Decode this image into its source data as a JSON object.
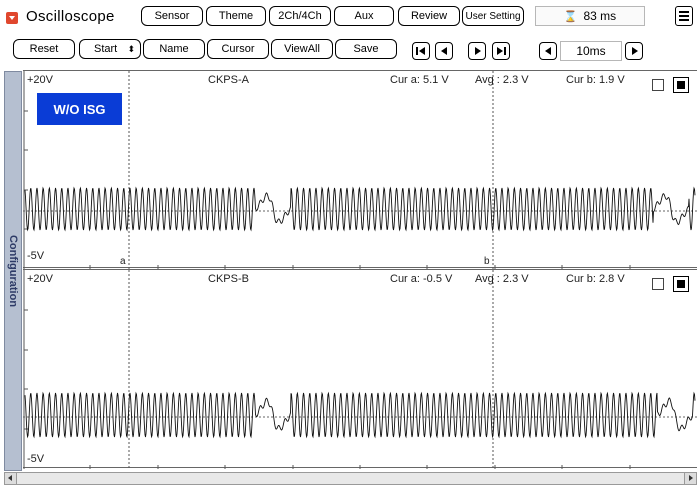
{
  "app": {
    "title": "Oscilloscope",
    "icon": "dropdown-icon"
  },
  "toolbar1": {
    "sensor": "Sensor",
    "theme": "Theme",
    "channels": "2Ch/4Ch",
    "aux": "Aux",
    "review": "Review",
    "user_setting": "User Setting",
    "timer": "83 ms",
    "timer_icon": "hourglass-icon"
  },
  "toolbar2": {
    "reset": "Reset",
    "start": "Start",
    "name": "Name",
    "cursor": "Cursor",
    "viewall": "ViewAll",
    "save": "Save",
    "timebase": "10ms"
  },
  "side_tab": {
    "label": "Configuration"
  },
  "channels": [
    {
      "name": "CKPS-A",
      "top_label": "+20V",
      "bottom_label": "-5V",
      "cur_a": "Cur a: 5.1 V",
      "avg": "Avg : 2.3 V",
      "cur_b": "Cur b: 1.9 V",
      "badge": "W/O ISG",
      "marker_a": "a",
      "marker_b": "b"
    },
    {
      "name": "CKPS-B",
      "top_label": "+20V",
      "bottom_label": "-5V",
      "cur_a": "Cur a: -0.5 V",
      "avg": "Avg : 2.3 V",
      "cur_b": "Cur b: 2.8 V"
    }
  ],
  "colors": {
    "badge": "#0a3cd6",
    "app_icon": "#e0472e",
    "side_tab": "#b5bfd0"
  }
}
